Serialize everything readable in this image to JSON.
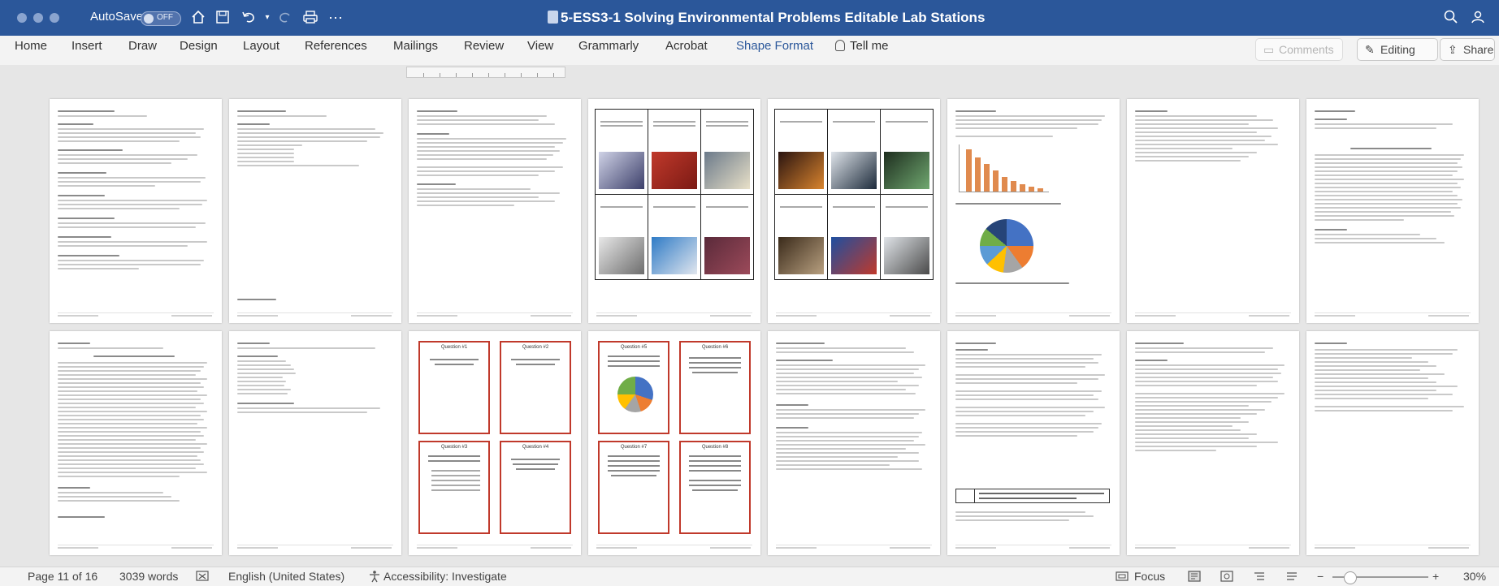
{
  "window": {
    "title": "5-ESS3-1 Solving Environmental Problems Editable Lab Stations",
    "autosave_label": "AutoSave",
    "autosave_state": "OFF",
    "accent": "#2b579a"
  },
  "ribbon": {
    "tabs": [
      "Home",
      "Insert",
      "Draw",
      "Design",
      "Layout",
      "References",
      "Mailings",
      "Review",
      "View",
      "Grammarly",
      "Acrobat",
      "Shape Format"
    ],
    "active_tab": "Shape Format",
    "tell_me": "Tell me",
    "comments_label": "Comments",
    "editing_label": "Editing",
    "share_label": "Share"
  },
  "icons": {
    "home": "home-icon",
    "save": "save-icon",
    "undo": "undo-icon",
    "redo": "redo-icon",
    "print": "print-icon",
    "more": "more-icon",
    "search": "search-icon",
    "account": "account-icon",
    "lightbulb": "lightbulb-icon"
  },
  "status": {
    "page": "Page 11 of 16",
    "words": "3039 words",
    "language": "English (United States)",
    "accessibility": "Accessibility: Investigate",
    "focus": "Focus",
    "zoom": "30%",
    "zoom_out": "−",
    "zoom_in": "+"
  },
  "pages": {
    "p3_cards": [
      "Question #1",
      "Question #2",
      "Question #3",
      "Question #4"
    ],
    "p4_cards": [
      "Question #5",
      "Question #6",
      "Question #7",
      "Question #8"
    ]
  }
}
